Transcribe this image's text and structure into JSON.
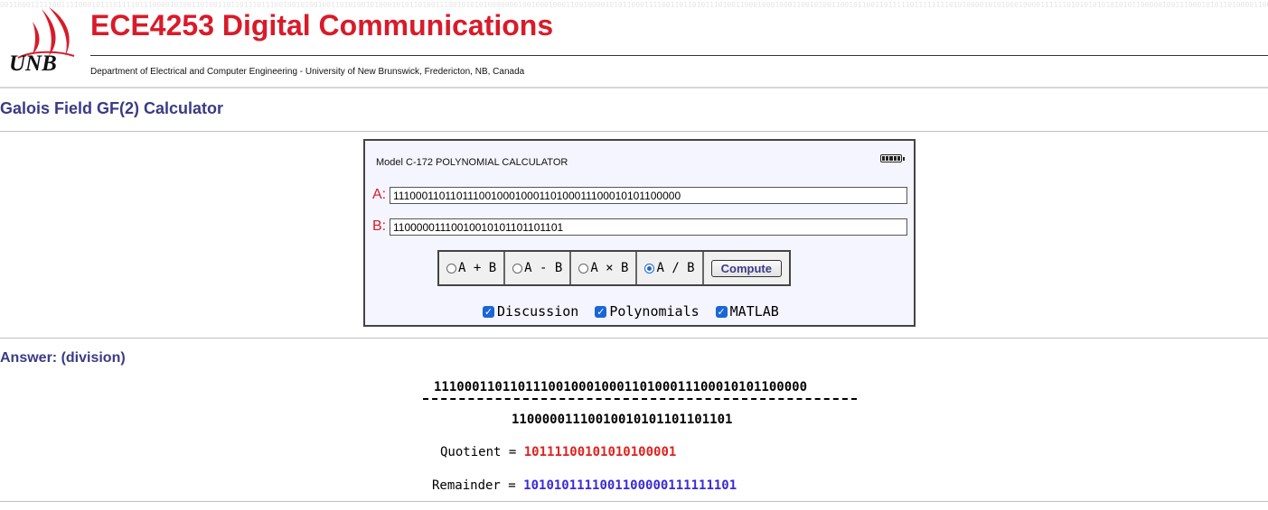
{
  "header": {
    "logo_text": "UNB",
    "title": "ECE4253 Digital Communications",
    "subtitle": "Department of Electrical and Computer Engineering - University of New Brunswick, Fredericton, NB, Canada"
  },
  "page_title": "Galois Field GF(2) Calculator",
  "calculator": {
    "model": "Model C-172 POLYNOMIAL CALCULATOR",
    "a_label": "A:",
    "a_value": "1110001101101110010001000110100011100010101100000",
    "b_label": "B:",
    "b_value": "11000001110010010101101101101",
    "operations": [
      {
        "label": "A + B",
        "selected": false
      },
      {
        "label": "A - B",
        "selected": false
      },
      {
        "label": "A × B",
        "selected": false
      },
      {
        "label": "A / B",
        "selected": true
      }
    ],
    "compute_label": "Compute",
    "checkboxes": [
      {
        "label": "Discussion",
        "checked": true
      },
      {
        "label": "Polynomials",
        "checked": true
      },
      {
        "label": "MATLAB",
        "checked": true
      }
    ]
  },
  "answer": {
    "title": "Answer: (division)",
    "dividend": "1110001101101110010001000110100011100010101100000",
    "divisor": "11000001110010010101101101101",
    "quotient_label": "Quotient =",
    "quotient": "10111100101010100001",
    "remainder_label": "Remainder =",
    "remainder": "1010101111001100000111111101"
  },
  "colors": {
    "title_red": "#d81b2a",
    "heading_purple": "#3b3a86",
    "quotient_red": "#e0201c",
    "remainder_blue": "#3b2ad6",
    "checkbox_blue": "#1a66d6"
  }
}
